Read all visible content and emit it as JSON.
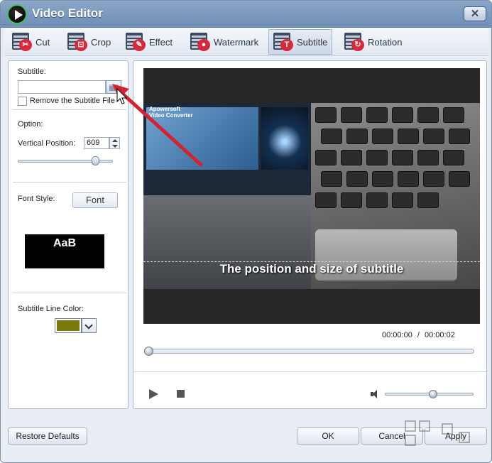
{
  "window": {
    "title": "Video Editor",
    "close_label": "✕"
  },
  "toolbar": {
    "tools": [
      {
        "label": "Cut",
        "badge": "✂",
        "color": "#d9283a"
      },
      {
        "label": "Crop",
        "badge": "⊡",
        "color": "#d9283a"
      },
      {
        "label": "Effect",
        "badge": "✎",
        "color": "#d9283a"
      },
      {
        "label": "Watermark",
        "badge": "●",
        "color": "#d9283a"
      },
      {
        "label": "Subtitle",
        "badge": "T",
        "color": "#d9283a",
        "active": true
      },
      {
        "label": "Rotation",
        "badge": "↻",
        "color": "#d9283a"
      }
    ]
  },
  "left": {
    "subtitle_label": "Subtitle:",
    "subtitle_value": "",
    "remove_label": "Remove the Subtitle File",
    "option_label": "Option:",
    "vpos_label": "Vertical Position:",
    "vpos_value": "609",
    "vpos_level": 0.84,
    "font_style_label": "Font Style:",
    "font_button": "Font",
    "font_preview": "AaB",
    "line_color_label": "Subtitle Line Color:",
    "line_color": "#7a7a0c"
  },
  "player": {
    "preview_title": "Apowersoft\nVideo Converter",
    "subtitle_preview": "The position and size of subtitle",
    "time_current": "00:00:00",
    "time_sep": "/",
    "time_total": "00:00:02",
    "seek_level": 0.0,
    "volume_level": 0.5
  },
  "footer": {
    "restore": "Restore Defaults",
    "ok": "OK",
    "cancel": "Cancel",
    "apply": "Apply"
  },
  "icons": {
    "app": "play-logo-icon",
    "browse": "folder-icon",
    "arrow": "red-pointer-arrow"
  }
}
